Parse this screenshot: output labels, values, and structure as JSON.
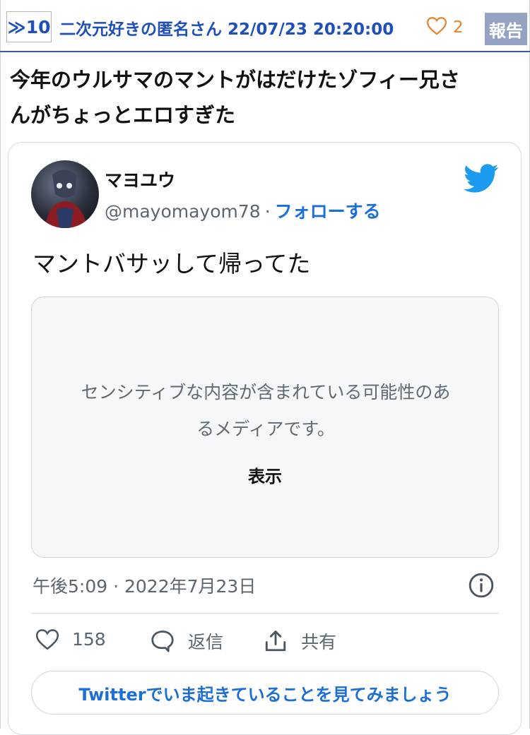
{
  "post": {
    "anchor": "≫10",
    "meta": "二次元好きの匿名さん 22/07/23 20:20:00",
    "like_count": "2",
    "report_label": "報告",
    "title_line1": "今年のウルサマのマントがはだけたゾフィー兄さ",
    "title_line2": "んがちょっとエロすぎた"
  },
  "tweet": {
    "display_name": "マヨユウ",
    "handle": "@mayomayom78",
    "separator": "·",
    "follow_label": "フォローする",
    "text": "マントバサッして帰ってた",
    "media_notice_line1": "センシティブな内容が含まれている可能性のあ",
    "media_notice_line2": "るメディアです。",
    "media_show_label": "表示",
    "timestamp": "午後5:09 · 2022年7月23日",
    "like_count": "158",
    "reply_label": "返信",
    "share_label": "共有",
    "cta_label": "Twitterでいま起きていることを見てみましょう"
  },
  "icons": {
    "heart": "heart-icon",
    "twitter": "twitter-bird-icon",
    "info": "info-icon",
    "reply": "speech-bubble-icon",
    "share": "share-upload-icon"
  },
  "colors": {
    "link_blue": "#1f4fb8",
    "twitter_blue": "#1d9bf0",
    "like_orange": "#e8822a",
    "report_bg": "#95a3c2"
  }
}
